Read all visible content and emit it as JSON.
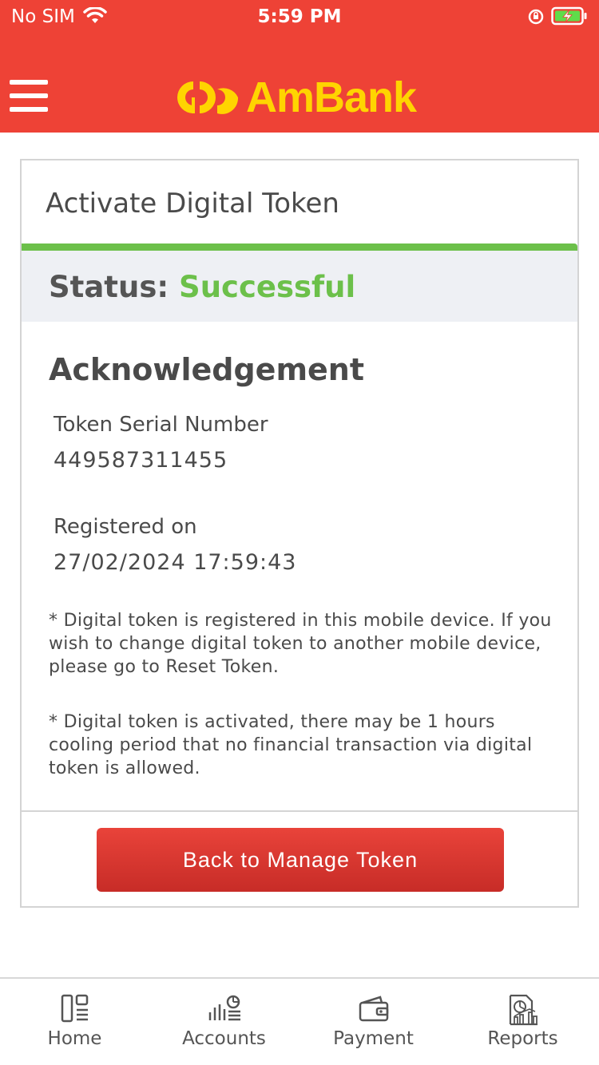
{
  "status_bar": {
    "carrier": "No SIM",
    "time": "5:59 PM"
  },
  "header": {
    "brand": "AmBank",
    "brand_color": "#ffd400",
    "background": "#ee4236"
  },
  "card": {
    "title": "Activate Digital Token",
    "status_label": "Status:",
    "status_value": "Successful",
    "status_color": "#6cc04a",
    "ack_title": "Acknowledgement",
    "serial_label": "Token Serial Number",
    "serial_value": "449587311455",
    "registered_label": "Registered on",
    "registered_value": "27/02/2024 17:59:43",
    "note1": "* Digital token is registered in this mobile device. If you wish to change digital token to another mobile device, please go to Reset Token.",
    "note2": "* Digital token is activated, there may be 1 hours cooling period that no financial transaction via digital token is allowed.",
    "back_button": "Back to Manage Token"
  },
  "tabs": [
    {
      "label": "Home",
      "icon": "home-icon"
    },
    {
      "label": "Accounts",
      "icon": "accounts-icon"
    },
    {
      "label": "Payment",
      "icon": "wallet-icon"
    },
    {
      "label": "Reports",
      "icon": "reports-icon"
    }
  ]
}
